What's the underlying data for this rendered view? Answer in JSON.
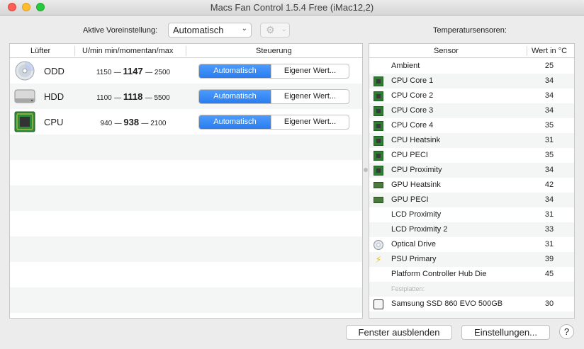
{
  "window": {
    "title": "Macs Fan Control 1.5.4 Free (iMac12,2)"
  },
  "toolbar": {
    "preset_label": "Aktive Voreinstellung:",
    "preset_value": "Automatisch",
    "gear_icon": "gear-icon",
    "sensors_label": "Temperatursensoren:"
  },
  "fans": {
    "headers": {
      "fan": "Lüfter",
      "rpm": "U/min min/momentan/max",
      "control": "Steuerung"
    },
    "rows": [
      {
        "name": "ODD",
        "icon": "optical-drive-icon",
        "min": "1150",
        "current": "1147",
        "max": "2500",
        "auto_label": "Automatisch",
        "custom_label": "Eigener Wert..."
      },
      {
        "name": "HDD",
        "icon": "hard-drive-icon",
        "min": "1100",
        "current": "1118",
        "max": "5500",
        "auto_label": "Automatisch",
        "custom_label": "Eigener Wert..."
      },
      {
        "name": "CPU",
        "icon": "cpu-chip-icon",
        "min": "940",
        "current": "938",
        "max": "2100",
        "auto_label": "Automatisch",
        "custom_label": "Eigener Wert..."
      }
    ]
  },
  "sensors": {
    "headers": {
      "sensor": "Sensor",
      "value": "Wert in °C"
    },
    "rows": [
      {
        "name": "Ambient",
        "value": "25",
        "icon": "none"
      },
      {
        "name": "CPU Core 1",
        "value": "34",
        "icon": "chip"
      },
      {
        "name": "CPU Core 2",
        "value": "34",
        "icon": "chip"
      },
      {
        "name": "CPU Core 3",
        "value": "34",
        "icon": "chip"
      },
      {
        "name": "CPU Core 4",
        "value": "35",
        "icon": "chip"
      },
      {
        "name": "CPU Heatsink",
        "value": "31",
        "icon": "chip"
      },
      {
        "name": "CPU PECI",
        "value": "35",
        "icon": "chip"
      },
      {
        "name": "CPU Proximity",
        "value": "34",
        "icon": "chip"
      },
      {
        "name": "GPU Heatsink",
        "value": "42",
        "icon": "gpu"
      },
      {
        "name": "GPU PECI",
        "value": "34",
        "icon": "gpu"
      },
      {
        "name": "LCD Proximity",
        "value": "31",
        "icon": "none"
      },
      {
        "name": "LCD Proximity 2",
        "value": "33",
        "icon": "none"
      },
      {
        "name": "Optical Drive",
        "value": "31",
        "icon": "disc"
      },
      {
        "name": "PSU Primary",
        "value": "39",
        "icon": "bolt"
      },
      {
        "name": "Platform Controller Hub Die",
        "value": "45",
        "icon": "none"
      }
    ],
    "section_disks": "Festplatten:",
    "disks": [
      {
        "name": "Samsung SSD 860 EVO 500GB",
        "value": "30",
        "icon": "ssd"
      }
    ]
  },
  "footer": {
    "hide_label": "Fenster ausblenden",
    "settings_label": "Einstellungen...",
    "help_label": "?"
  }
}
